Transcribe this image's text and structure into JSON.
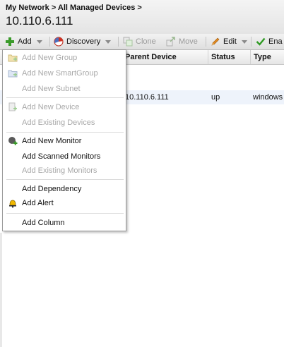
{
  "breadcrumb": {
    "items": [
      "My Network",
      "All Managed Devices"
    ],
    "separator": ">"
  },
  "page_title": "10.110.6.111",
  "toolbar": {
    "add": "Add",
    "discovery": "Discovery",
    "clone": "Clone",
    "move": "Move",
    "edit": "Edit",
    "enable": "Ena"
  },
  "grid": {
    "columns": [
      "Parent Device",
      "Status",
      "Type"
    ],
    "rows": [
      {
        "parent_device": "10.110.6.111",
        "status": "up",
        "type": "windows"
      }
    ]
  },
  "add_menu": {
    "items": [
      {
        "label": "Add New Group",
        "icon": "folder-add-icon",
        "enabled": false
      },
      {
        "label": "Add New SmartGroup",
        "icon": "smart-folder-icon",
        "enabled": false
      },
      {
        "label": "Add New Subnet",
        "icon": null,
        "enabled": false
      },
      {
        "label": "Add New Device",
        "icon": "device-add-icon",
        "enabled": false
      },
      {
        "label": "Add Existing Devices",
        "icon": null,
        "enabled": false
      },
      {
        "label": "Add New Monitor",
        "icon": "monitor-add-icon",
        "enabled": true
      },
      {
        "label": "Add Scanned Monitors",
        "icon": null,
        "enabled": true
      },
      {
        "label": "Add Existing Monitors",
        "icon": null,
        "enabled": false
      },
      {
        "label": "Add Dependency",
        "icon": null,
        "enabled": true
      },
      {
        "label": "Add Alert",
        "icon": "bell-icon",
        "enabled": true
      },
      {
        "label": "Add Column",
        "icon": null,
        "enabled": true
      }
    ]
  },
  "colors": {
    "toolbar_bg": "#e6e6e6",
    "selected_row_bg": "#eef3fb",
    "disabled_text": "#a8a8a8",
    "add_icon_green": "#3a9a2a",
    "enable_check_green": "#2e9a22",
    "discovery_red": "#d03020",
    "edit_pencil_orange": "#e08a20",
    "alert_bell_yellow": "#f0b800"
  }
}
